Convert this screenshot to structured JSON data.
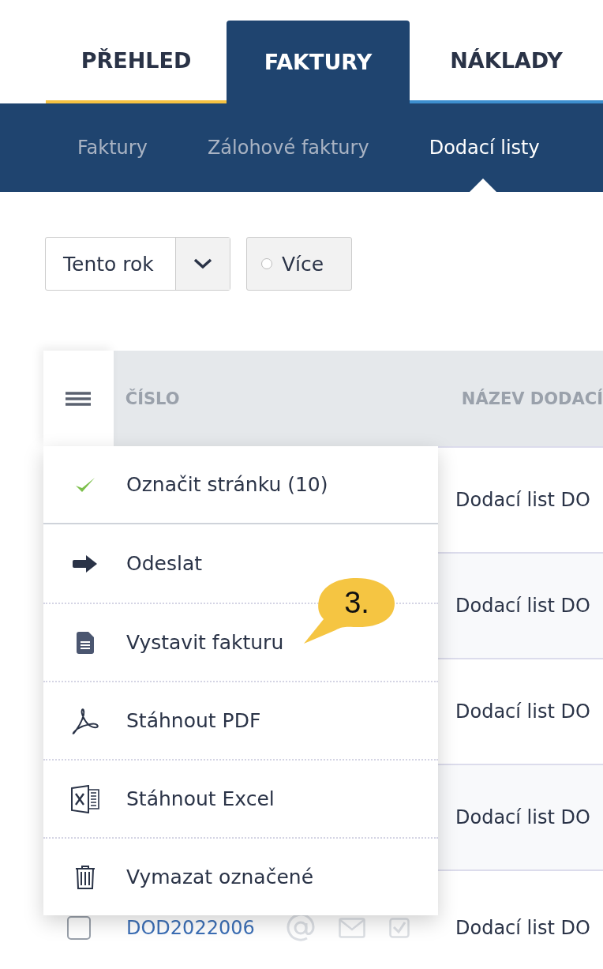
{
  "tabs": [
    {
      "label": "PŘEHLED",
      "selected": false,
      "color": "#f5c242"
    },
    {
      "label": "FAKTURY",
      "selected": true,
      "color": "#1f446f"
    },
    {
      "label": "NÁKLADY",
      "selected": false,
      "color": "#3d8fcf"
    }
  ],
  "subtabs": [
    {
      "label": "Faktury",
      "selected": false
    },
    {
      "label": "Zálohové faktury",
      "selected": false
    },
    {
      "label": "Dodací listy",
      "selected": true
    }
  ],
  "filters": {
    "period": "Tento rok",
    "more": "Více"
  },
  "table": {
    "columns": [
      "ČÍSLO",
      "NÁZEV DODACÍ"
    ],
    "rows": [
      {
        "name": "Dodací list DO"
      },
      {
        "name": "Dodací list DO"
      },
      {
        "name": "Dodací list DO"
      },
      {
        "name": "Dodací list DO"
      },
      {
        "number": "DOD2022006",
        "checked": false,
        "name": "Dodací list DO"
      }
    ]
  },
  "menu": [
    {
      "kind": "check",
      "label": "Označit stránku (10)"
    },
    {
      "kind": "send",
      "label": "Odeslat"
    },
    {
      "kind": "document",
      "label": "Vystavit fakturu"
    },
    {
      "kind": "pdf",
      "label": "Stáhnout PDF"
    },
    {
      "kind": "excel",
      "label": "Stáhnout Excel"
    },
    {
      "kind": "trash",
      "label": "Vymazat označené"
    }
  ],
  "callout": {
    "text": "3."
  }
}
